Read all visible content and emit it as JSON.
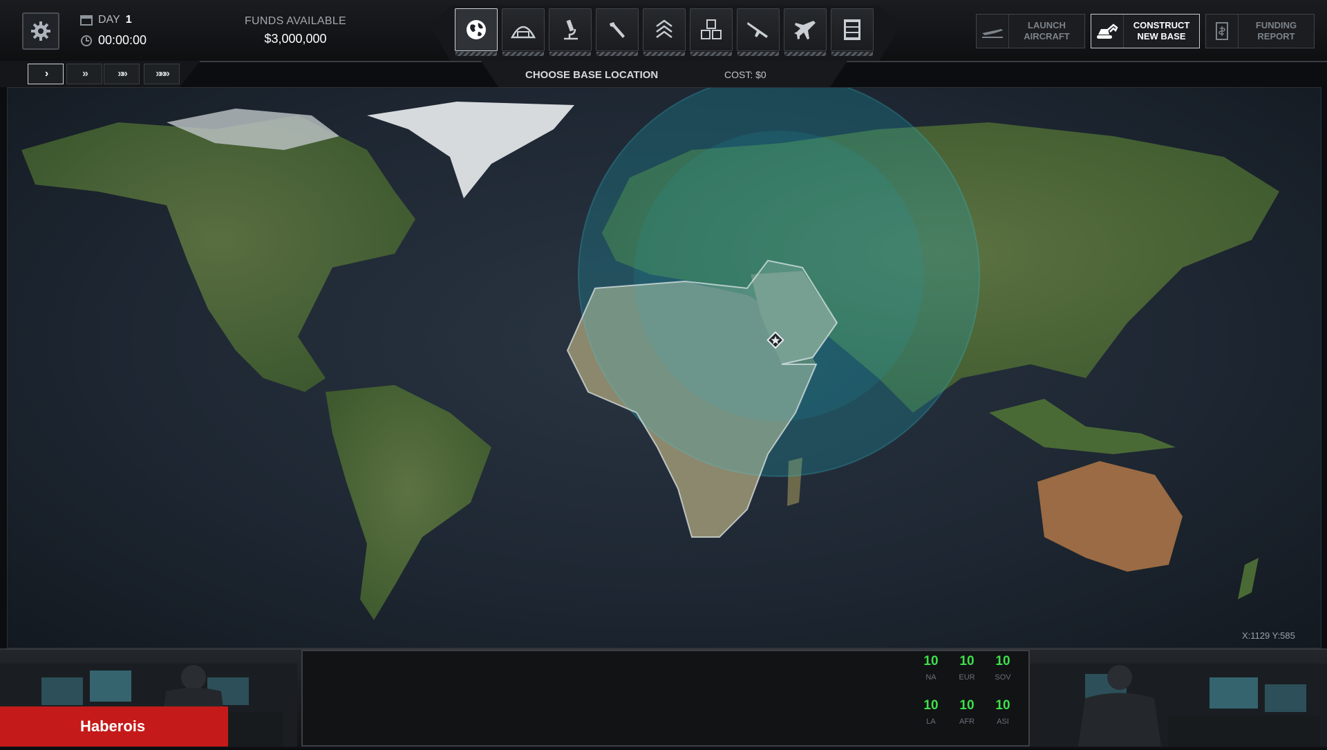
{
  "header": {
    "day_label": "DAY",
    "day_value": "1",
    "clock": "00:00:00",
    "funds_label": "FUNDS AVAILABLE",
    "funds_value": "$3,000,000"
  },
  "tabs": [
    {
      "name": "globe-icon"
    },
    {
      "name": "hangar-icon"
    },
    {
      "name": "microscope-icon"
    },
    {
      "name": "wrench-icon"
    },
    {
      "name": "rank-chevrons-icon"
    },
    {
      "name": "storage-crates-icon"
    },
    {
      "name": "rifle-icon"
    },
    {
      "name": "jet-icon"
    },
    {
      "name": "archive-cabinet-icon"
    }
  ],
  "actions": {
    "launch_aircraft": "LAUNCH\nAIRCRAFT",
    "construct_new_base": "CONSTRUCT\nNEW BASE",
    "funding_report": "FUNDING\nREPORT"
  },
  "speeds": [
    {
      "label": "›"
    },
    {
      "label": "»"
    },
    {
      "label": "»»"
    },
    {
      "label": "»»»"
    }
  ],
  "placement": {
    "title": "CHOOSE BASE LOCATION",
    "cost": "COST: $0"
  },
  "cursor": {
    "readout": "X:1129   Y:585"
  },
  "regions": [
    {
      "code": "NA",
      "value": "10"
    },
    {
      "code": "EUR",
      "value": "10"
    },
    {
      "code": "SOV",
      "value": "10"
    },
    {
      "code": "LA",
      "value": "10"
    },
    {
      "code": "AFR",
      "value": "10"
    },
    {
      "code": "ASI",
      "value": "10"
    }
  ],
  "player": {
    "name": "Haberois"
  },
  "colors": {
    "region_stat": "#3ee04a",
    "player_tag": "#c51a1a",
    "radar_range": "#1ea3b3"
  }
}
